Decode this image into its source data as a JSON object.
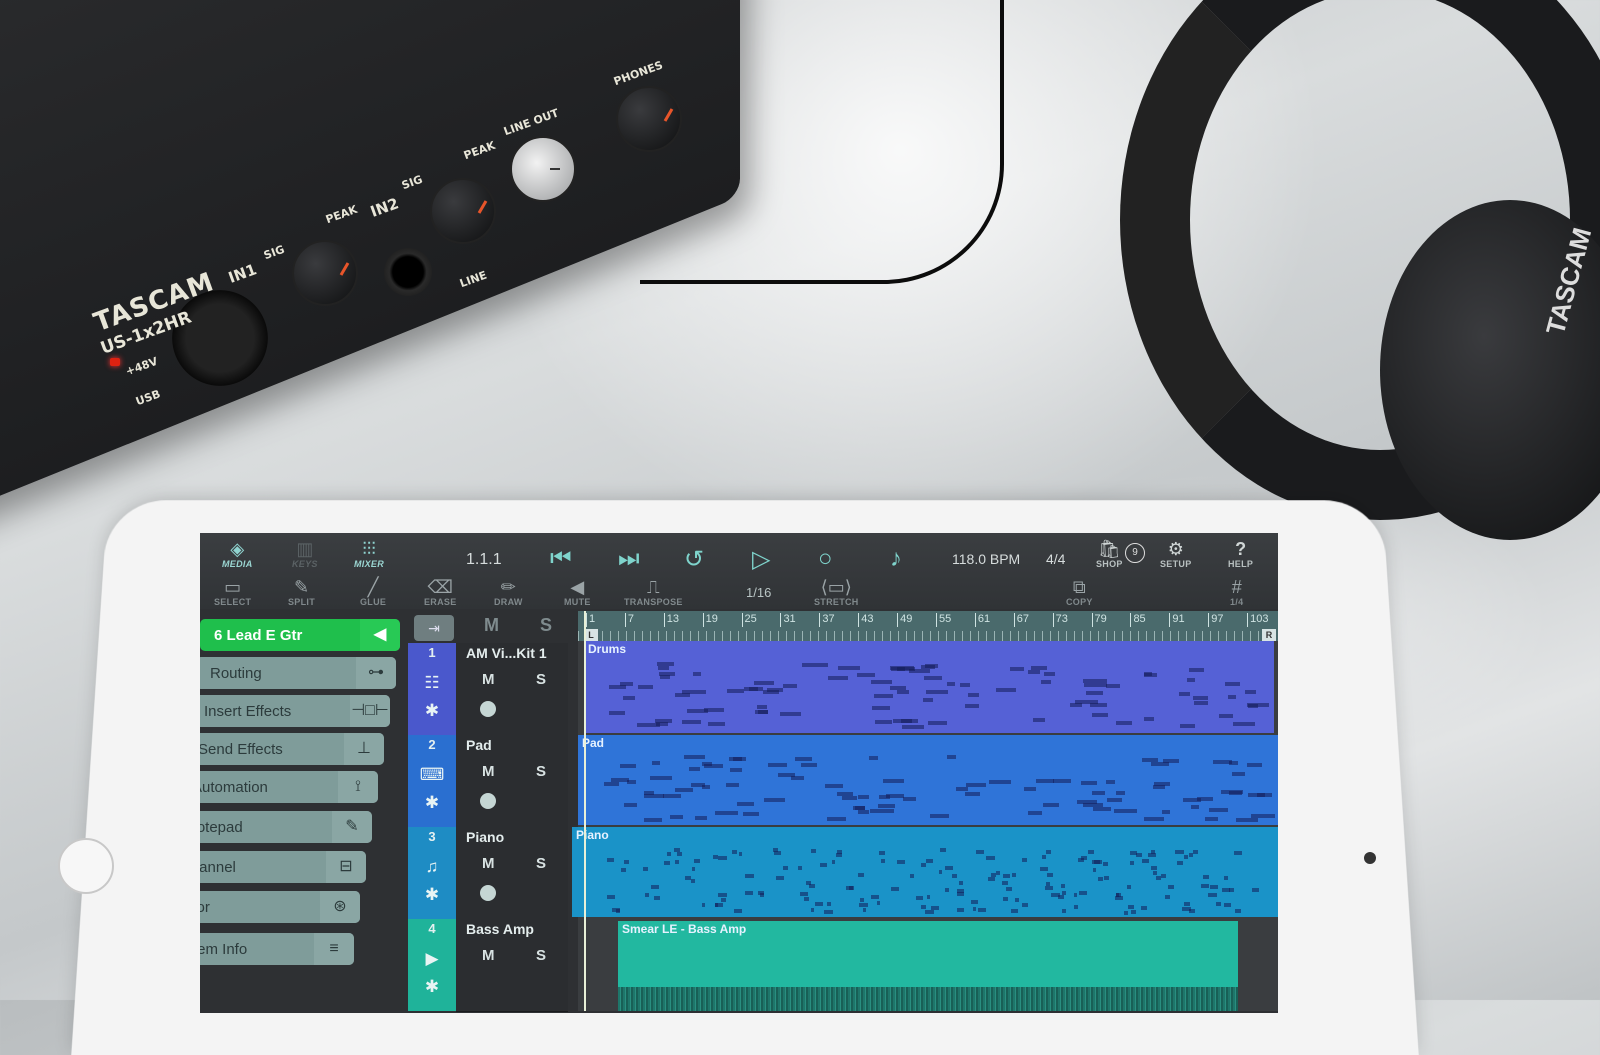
{
  "hardware": {
    "brand": "TASCAM",
    "model": "US-1x2HR",
    "labels": {
      "in1": "IN1",
      "in2": "IN2",
      "sig1": "SIG",
      "sig2": "SIG",
      "peak1": "PEAK",
      "peak2": "PEAK",
      "phantom": "+48V",
      "usb": "USB",
      "line_out": "LINE OUT",
      "phones": "PHONES",
      "line": "LINE"
    },
    "headphones_brand": "TASCAM"
  },
  "toolbar": {
    "row1": [
      {
        "id": "media",
        "label": "MEDIA",
        "icon": "media-box-icon",
        "glyph": "◈",
        "active": true
      },
      {
        "id": "keys",
        "label": "KEYS",
        "icon": "keys-icon",
        "glyph": "▥",
        "active": false
      },
      {
        "id": "mixer",
        "label": "MIXER",
        "icon": "mixer-faders-icon",
        "glyph": "⫶⫶⫶",
        "active": true
      }
    ],
    "position": "1.1.1",
    "transport": {
      "rewind": "⏮",
      "forward": "⏭",
      "loop": "↺",
      "play": "▷",
      "record": "○",
      "metronome": "♪"
    },
    "tempo": "118.0 BPM",
    "time_signature": "4/4",
    "right_buttons": [
      {
        "id": "shop",
        "label": "SHOP",
        "icon": "shop-bag-icon",
        "glyph": "🛍",
        "badge": "9"
      },
      {
        "id": "setup",
        "label": "SETUP",
        "icon": "gear-icon",
        "glyph": "⚙"
      },
      {
        "id": "help",
        "label": "HELP",
        "icon": "help-question-icon",
        "glyph": "?"
      }
    ],
    "row2": [
      {
        "id": "select",
        "label": "SELECT",
        "icon": "select-rect-icon",
        "glyph": "▭",
        "enabled": true
      },
      {
        "id": "split",
        "label": "SPLIT",
        "icon": "split-icon",
        "glyph": "✎",
        "enabled": true
      },
      {
        "id": "glue",
        "label": "GLUE",
        "icon": "glue-icon",
        "glyph": "╱",
        "enabled": false
      },
      {
        "id": "erase",
        "label": "ERASE",
        "icon": "eraser-icon",
        "glyph": "⌫",
        "enabled": true
      },
      {
        "id": "draw",
        "label": "DRAW",
        "icon": "pencil-icon",
        "glyph": "✏",
        "enabled": true
      },
      {
        "id": "mute",
        "label": "MUTE",
        "icon": "speaker-mute-icon",
        "glyph": "◀",
        "enabled": true
      },
      {
        "id": "transpose",
        "label": "TRANSPOSE",
        "icon": "transpose-icon",
        "glyph": "⎍",
        "enabled": true
      }
    ],
    "quantize": "1/16",
    "stretch_label": "STRETCH",
    "copy_label": "COPY",
    "grid_label": "1/4"
  },
  "side_panel": {
    "selected_track": "6  Lead E Gtr",
    "items": [
      {
        "label": "Routing",
        "icon": "routing-icon",
        "glyph": "⊶"
      },
      {
        "label": "Insert Effects",
        "icon": "insert-effects-icon",
        "glyph": "⊣□⊢"
      },
      {
        "label": "Send Effects",
        "icon": "send-effects-icon",
        "glyph": "⊥"
      },
      {
        "label": "Automation",
        "icon": "automation-nodes-icon",
        "glyph": "⟟"
      },
      {
        "label": "Notepad",
        "icon": "notepad-edit-icon",
        "glyph": "✎"
      },
      {
        "label": "Channel",
        "icon": "channel-fader-icon",
        "glyph": "⊟"
      },
      {
        "label": "Color",
        "icon": "color-circles-icon",
        "glyph": "⊛"
      },
      {
        "label": "System Info",
        "icon": "menu-lines-icon",
        "glyph": "≡"
      }
    ]
  },
  "track_header": {
    "mute_label": "M",
    "solo_label": "S"
  },
  "tracks": [
    {
      "number": "1",
      "name": "AM Vi...Kit 1",
      "color": "#4a58cc",
      "icon": "drum-icon",
      "glyph": "☷",
      "mute": "M",
      "solo": "S"
    },
    {
      "number": "2",
      "name": "Pad",
      "color": "#2a6fd0",
      "icon": "synth-keys-icon",
      "glyph": "⌨",
      "mute": "M",
      "solo": "S"
    },
    {
      "number": "3",
      "name": "Piano",
      "color": "#1e8cc4",
      "icon": "grand-piano-icon",
      "glyph": "♫",
      "mute": "M",
      "solo": "S"
    },
    {
      "number": "4",
      "name": "Bass Amp",
      "color": "#1fb39a",
      "icon": "play-audio-icon",
      "glyph": "▶",
      "mute": "M",
      "solo": "S"
    }
  ],
  "ruler": {
    "bars": [
      "1",
      "7",
      "13",
      "19",
      "25",
      "31",
      "37",
      "43",
      "49",
      "55",
      "61",
      "67",
      "73",
      "79",
      "85",
      "91",
      "97",
      "103"
    ],
    "left_locator": "L",
    "right_locator": "R"
  },
  "regions": [
    {
      "label": "Drums",
      "color": "#5561d6",
      "track": 1
    },
    {
      "label": "Pad",
      "color": "#2f74d8",
      "track": 2
    },
    {
      "label": "Piano",
      "color": "#1a93c8",
      "track": 3
    },
    {
      "label": "Smear LE - Bass Amp",
      "color": "#22b8a0",
      "track": 4
    }
  ]
}
